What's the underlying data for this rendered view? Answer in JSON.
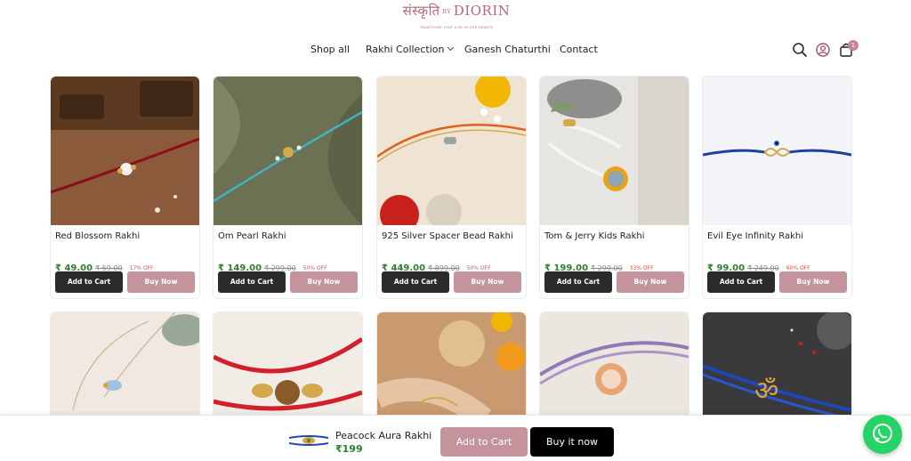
{
  "brand": {
    "logo_main": "संस्कृति",
    "logo_by": "BY",
    "logo_name": "DIORIN",
    "tagline": "TRADITIONS THAT LIVE IN OUR HEARTS"
  },
  "nav": {
    "items": [
      "Shop all",
      "Rakhi Collection",
      "Ganesh Chaturthi",
      "Contact"
    ]
  },
  "header_icons": {
    "search": "search-icon",
    "account": "user-icon",
    "cart": "bag-icon",
    "cart_count": "1"
  },
  "products": [
    {
      "title": "Red Blossom Rakhi",
      "price": "₹ 49.00",
      "mrp": "₹ 59.00",
      "discount": "17% OFF",
      "add_label": "Add to Cart",
      "buy_label": "Buy Now"
    },
    {
      "title": "Om Pearl Rakhi",
      "price": "₹ 149.00",
      "mrp": "₹ 299.00",
      "discount": "50% OFF",
      "add_label": "Add to Cart",
      "buy_label": "Buy Now"
    },
    {
      "title": "925 Silver Spacer Bead Rakhi",
      "price": "₹ 449.00",
      "mrp": "₹ 899.00",
      "discount": "50% OFF",
      "add_label": "Add to Cart",
      "buy_label": "Buy Now"
    },
    {
      "title": "Tom & Jerry Kids Rakhi",
      "price": "₹ 199.00",
      "mrp": "₹ 299.00",
      "discount": "33% OFF",
      "add_label": "Add to Cart",
      "buy_label": "Buy Now"
    },
    {
      "title": "Evil Eye Infinity Rakhi",
      "price": "₹ 99.00",
      "mrp": "₹ 249.00",
      "discount": "60% OFF",
      "add_label": "Add to Cart",
      "buy_label": "Buy Now"
    }
  ],
  "sticky_bar": {
    "title": "Peacock Aura Rakhi",
    "price": "₹199",
    "add_label": "Add to Cart",
    "buy_label": "Buy it now"
  },
  "colors": {
    "brand_pink": "#c4939c",
    "price_green": "#2e7d32",
    "discount_red": "#d9534f",
    "whatsapp_green": "#25d366"
  }
}
